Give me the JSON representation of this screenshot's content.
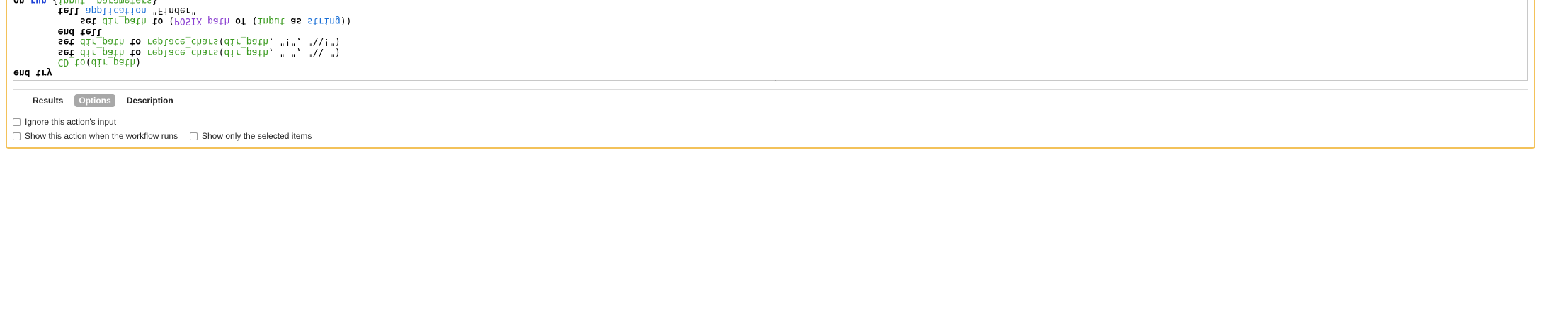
{
  "code": {
    "lines": [
      [
        {
          "t": "",
          "c": ""
        }
      ],
      [
        {
          "t": "        ",
          "c": ""
        },
        {
          "t": "CD_to",
          "c": "fn"
        },
        {
          "t": "(",
          "c": "str"
        },
        {
          "t": "dir_path",
          "c": "var"
        },
        {
          "t": ")",
          "c": "str"
        }
      ],
      [
        {
          "t": "        ",
          "c": ""
        },
        {
          "t": "set",
          "c": "kw"
        },
        {
          "t": " ",
          "c": ""
        },
        {
          "t": "dir_path",
          "c": "var"
        },
        {
          "t": " ",
          "c": ""
        },
        {
          "t": "to",
          "c": "kw"
        },
        {
          "t": " ",
          "c": ""
        },
        {
          "t": "replace_chars",
          "c": "fn"
        },
        {
          "t": "(",
          "c": "str"
        },
        {
          "t": "dir_path",
          "c": "var"
        },
        {
          "t": ", \" \", \"\\\\ \")",
          "c": "str"
        }
      ],
      [
        {
          "t": "        ",
          "c": ""
        },
        {
          "t": "set",
          "c": "kw"
        },
        {
          "t": " ",
          "c": ""
        },
        {
          "t": "dir_path",
          "c": "var"
        },
        {
          "t": " ",
          "c": ""
        },
        {
          "t": "to",
          "c": "kw"
        },
        {
          "t": " ",
          "c": ""
        },
        {
          "t": "replace_chars",
          "c": "fn"
        },
        {
          "t": "(",
          "c": "str"
        },
        {
          "t": "dir_path",
          "c": "var"
        },
        {
          "t": ", \"!\", \"\\\\!\")",
          "c": "str"
        }
      ],
      [
        {
          "t": "        ",
          "c": ""
        },
        {
          "t": "end",
          "c": "kw"
        },
        {
          "t": " ",
          "c": ""
        },
        {
          "t": "tell",
          "c": "kw"
        }
      ],
      [
        {
          "t": "            ",
          "c": ""
        },
        {
          "t": "set",
          "c": "kw"
        },
        {
          "t": " ",
          "c": ""
        },
        {
          "t": "dir_path",
          "c": "var"
        },
        {
          "t": " ",
          "c": ""
        },
        {
          "t": "to",
          "c": "kw"
        },
        {
          "t": " (",
          "c": "str"
        },
        {
          "t": "POSIX",
          "c": "prop"
        },
        {
          "t": " ",
          "c": ""
        },
        {
          "t": "path",
          "c": "prop"
        },
        {
          "t": " ",
          "c": ""
        },
        {
          "t": "of",
          "c": "kw"
        },
        {
          "t": " (",
          "c": "str"
        },
        {
          "t": "input",
          "c": "var"
        },
        {
          "t": " ",
          "c": ""
        },
        {
          "t": "as",
          "c": "kw"
        },
        {
          "t": " ",
          "c": ""
        },
        {
          "t": "string",
          "c": "cls"
        },
        {
          "t": "))",
          "c": "str"
        }
      ],
      [
        {
          "t": "        ",
          "c": ""
        },
        {
          "t": "tell",
          "c": "kw"
        },
        {
          "t": " ",
          "c": ""
        },
        {
          "t": "application",
          "c": "cls"
        },
        {
          "t": " \"Finder\"",
          "c": "str"
        }
      ],
      [
        {
          "t": "on",
          "c": "kw"
        },
        {
          "t": " ",
          "c": ""
        },
        {
          "t": "run",
          "c": "kwb"
        },
        {
          "t": " {",
          "c": "str"
        },
        {
          "t": "input",
          "c": "var"
        },
        {
          "t": ", ",
          "c": "str"
        },
        {
          "t": "parameters",
          "c": "var"
        },
        {
          "t": "}",
          "c": "str"
        }
      ]
    ],
    "first_partial": "end try"
  },
  "tabs": {
    "results": "Results",
    "options": "Options",
    "description": "Description"
  },
  "options": {
    "ignore_input": "Ignore this action's input",
    "show_action": "Show this action when the workflow runs",
    "show_selected": "Show only the selected items"
  },
  "colors": {
    "panel_border": "#f3c25a",
    "active_tab": "#a8a8a8",
    "keyword_blue": "#1a3fd6",
    "variable_green": "#3a9a1f",
    "property_purple": "#8a3fd0"
  }
}
